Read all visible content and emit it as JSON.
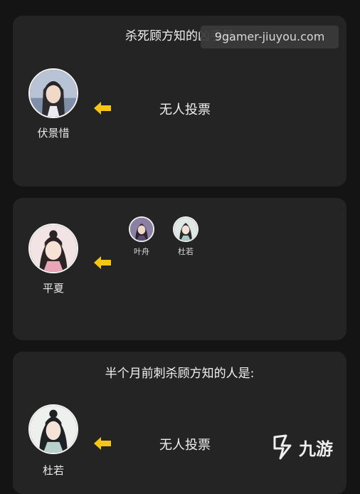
{
  "cards": [
    {
      "title": "杀死顾方知的凶手是",
      "player": "伏景惜",
      "result": "无人投票"
    },
    {
      "player": "平夏",
      "voters": [
        "叶舟",
        "杜若"
      ]
    },
    {
      "title": "半个月前刺杀顾方知的人是:",
      "player": "杜若",
      "result": "无人投票"
    }
  ],
  "watermark": "9gamer-jiuyou.com",
  "logo": {
    "text": "九游",
    "icon": "nine-game-logo-icon"
  },
  "colors": {
    "background": "#141414",
    "card": "#242424",
    "arrow": "#f5c518"
  }
}
